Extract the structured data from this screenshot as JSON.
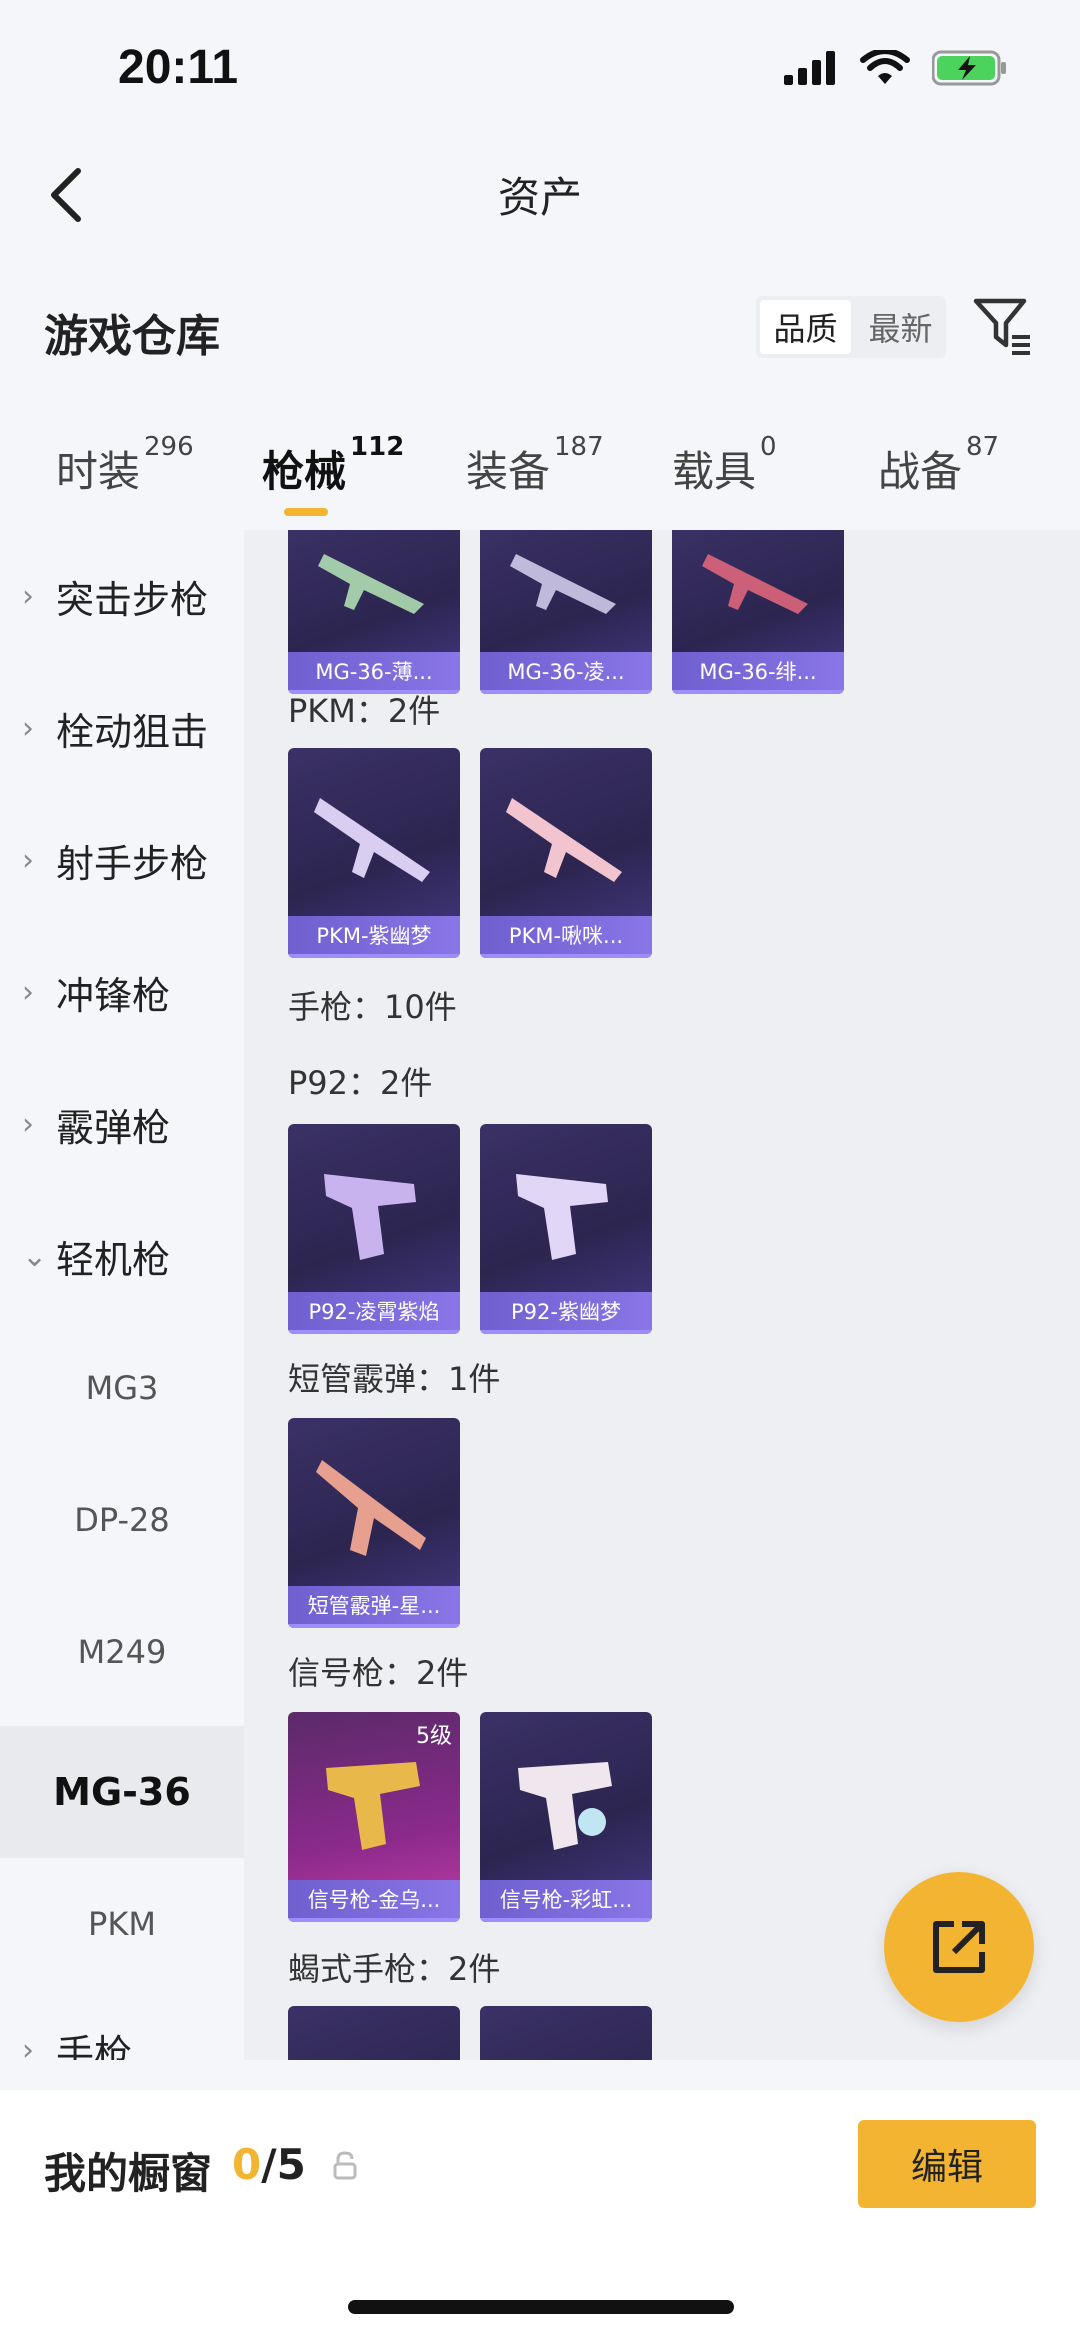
{
  "status": {
    "time": "20:11"
  },
  "nav": {
    "title": "资产"
  },
  "section": {
    "title": "游戏仓库",
    "sort_options": [
      "品质",
      "最新"
    ]
  },
  "tabs": [
    {
      "label": "时装",
      "count": "296"
    },
    {
      "label": "枪械",
      "count": "112"
    },
    {
      "label": "装备",
      "count": "187"
    },
    {
      "label": "载具",
      "count": "0"
    },
    {
      "label": "战备",
      "count": "87"
    }
  ],
  "sidebar": {
    "items": [
      {
        "label": "突击步枪",
        "chev": "›"
      },
      {
        "label": "栓动狙击",
        "chev": "›"
      },
      {
        "label": "射手步枪",
        "chev": "›"
      },
      {
        "label": "冲锋枪",
        "chev": "›"
      },
      {
        "label": "霰弹枪",
        "chev": "›"
      },
      {
        "label": "轻机枪",
        "chev": "⌄"
      },
      {
        "label": "MG3"
      },
      {
        "label": "DP-28"
      },
      {
        "label": "M249"
      },
      {
        "label": "MG-36"
      },
      {
        "label": "PKM"
      },
      {
        "label": "手枪",
        "chev": "›"
      }
    ]
  },
  "groups": {
    "mg36_cards": [
      "MG-36-薄...",
      "MG-36-凌...",
      "MG-36-绯..."
    ],
    "pkm_title": "PKM：2件",
    "pkm_cards": [
      "PKM-紫幽梦",
      "PKM-啾咪..."
    ],
    "pistol_title": "手枪：10件",
    "p92_title": "P92：2件",
    "p92_cards": [
      "P92-凌霄紫焰",
      "P92-紫幽梦"
    ],
    "shotgun_title": "短管霰弹：1件",
    "shotgun_cards": [
      "短管霰弹-星..."
    ],
    "flare_title": "信号枪：2件",
    "flare_cards": [
      "信号枪-金乌...",
      "信号枪-彩虹..."
    ],
    "flare_badge": "5级",
    "scorpion_title": "蝎式手枪：2件"
  },
  "bottom": {
    "window_label": "我的橱窗",
    "window_current": "0",
    "window_total": "/5",
    "edit_label": "编辑"
  },
  "colors": {
    "accent": "#f3b531",
    "card_caption": "#7d6be0"
  }
}
